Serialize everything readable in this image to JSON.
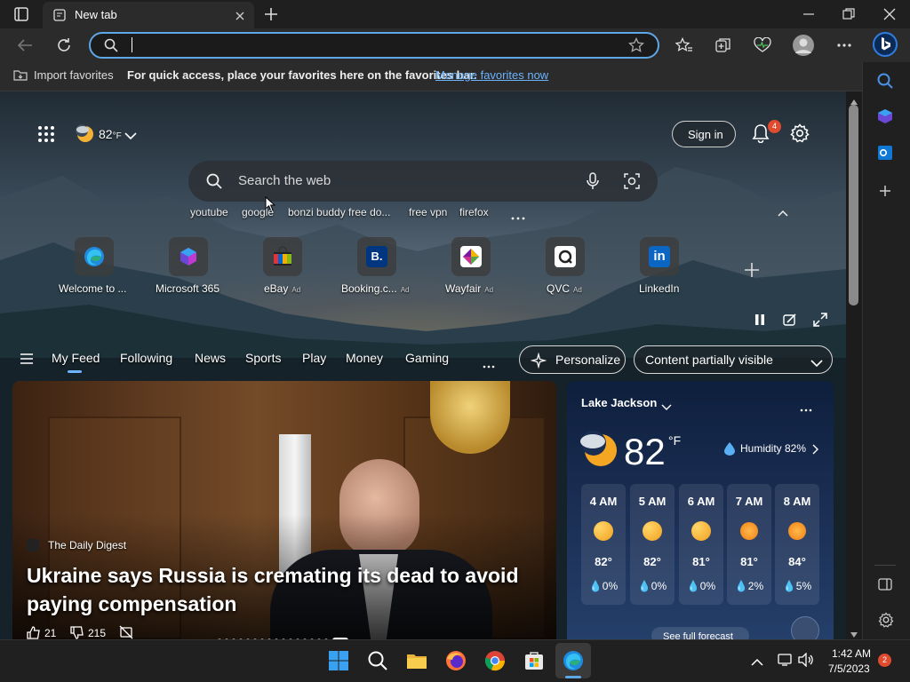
{
  "tab": {
    "title": "New tab"
  },
  "favorites_bar": {
    "import_label": "Import favorites",
    "message": "For quick access, place your favorites here on the favorites bar.",
    "manage_link": "Manage favorites now"
  },
  "header": {
    "weather_temp": "82",
    "weather_unit": "°F",
    "sign_in_label": "Sign in",
    "notification_count": "4"
  },
  "search": {
    "placeholder": "Search the web",
    "suggestions": [
      "youtube",
      "google",
      "bonzi buddy free do...",
      "free vpn",
      "firefox"
    ]
  },
  "quick_links": [
    {
      "label": "Welcome to ...",
      "ad": "",
      "color": "#0c59a4"
    },
    {
      "label": "Microsoft 365",
      "ad": "",
      "color": "#7a4cd9"
    },
    {
      "label": "eBay",
      "ad": "Ad",
      "color": "#e53238"
    },
    {
      "label": "Booking.c...",
      "ad": "Ad",
      "color": "#003580"
    },
    {
      "label": "Wayfair",
      "ad": "Ad",
      "color": "#7b189f"
    },
    {
      "label": "QVC",
      "ad": "Ad",
      "color": "#ffffff"
    },
    {
      "label": "LinkedIn",
      "ad": "",
      "color": "#0a66c2"
    }
  ],
  "feed_nav": {
    "items": [
      "My Feed",
      "Following",
      "News",
      "Sports",
      "Play",
      "Money",
      "Gaming"
    ],
    "personalize_label": "Personalize",
    "visibility_label": "Content partially visible"
  },
  "news": {
    "source": "The Daily Digest",
    "headline": "Ukraine says Russia is cremating its dead to avoid paying compensation",
    "likes": "21",
    "dislikes": "215"
  },
  "weather": {
    "location": "Lake Jackson",
    "temp": "82",
    "unit": "°F",
    "humidity": "Humidity 82%",
    "forecast_link": "See full forecast",
    "hours": [
      {
        "time": "4 AM",
        "temp": "82°",
        "precip": "0%",
        "icon": "moon-icon"
      },
      {
        "time": "5 AM",
        "temp": "82°",
        "precip": "0%",
        "icon": "moon-icon"
      },
      {
        "time": "6 AM",
        "temp": "81°",
        "precip": "0%",
        "icon": "moon-icon"
      },
      {
        "time": "7 AM",
        "temp": "81°",
        "precip": "2%",
        "icon": "sun-icon"
      },
      {
        "time": "8 AM",
        "temp": "84°",
        "precip": "5%",
        "icon": "sun-icon"
      }
    ]
  },
  "taskbar": {
    "time": "1:42 AM",
    "date": "7/5/2023",
    "notification_count": "2"
  },
  "colors": {
    "accent": "#5ea7e6",
    "link": "#6cb4ff",
    "badge": "#e04a2f"
  }
}
